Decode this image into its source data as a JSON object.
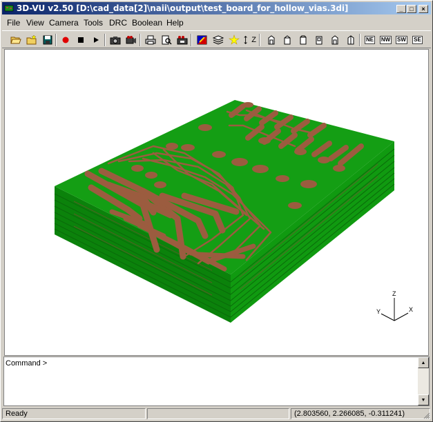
{
  "window": {
    "title": "3D-VU v2.50 [D:\\cad_data[2]\\naii\\output\\test_board_for_hollow_vias.3di]",
    "controls": {
      "minimize": "_",
      "maximize": "□",
      "close": "×"
    }
  },
  "menu": {
    "items": [
      "File",
      "View",
      "Camera",
      "Tools",
      "DRC",
      "Boolean",
      "Help"
    ]
  },
  "toolbar": {
    "view_labels": {
      "ne": "NE",
      "nw": "NW",
      "sw": "SW",
      "se": "SE"
    },
    "zoom_label": "Z"
  },
  "axes": {
    "x": "X",
    "y": "Y",
    "z": "Z"
  },
  "command": {
    "prompt": "Command >"
  },
  "status": {
    "text": "Ready",
    "coords": "(2.803560, 2.266085, -0.311241)"
  },
  "colors": {
    "board_top": "#109e10",
    "board_side": "#0d8a0d",
    "board_front": "#0a7a0a",
    "copper": "#9b5c3f",
    "title_start": "#0a246a",
    "title_end": "#a6caf0"
  }
}
